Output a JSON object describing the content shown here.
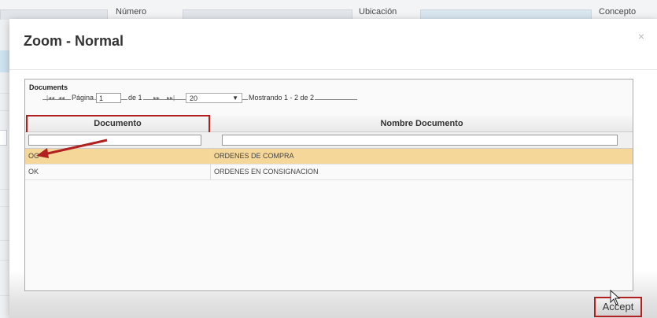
{
  "background": {
    "fields": [
      {
        "label": "Número"
      },
      {
        "label": "Ubicación"
      },
      {
        "label": "Concepto"
      }
    ]
  },
  "modal": {
    "title": "Zoom - Normal",
    "close_icon": "×"
  },
  "grid": {
    "caption": "Documents",
    "pager": {
      "first_icon": "|◂◂",
      "prev_icon": "◂◂",
      "page_label": "Página",
      "page_value": "1",
      "of_label": "de 1",
      "next_icon": "▸▸",
      "last_icon": "▸▸|",
      "page_size": "20",
      "dropdown_icon": "▼",
      "info": "Mostrando 1 - 2 de 2"
    },
    "columns": [
      "Documento",
      "Nombre Documento"
    ],
    "rows": [
      {
        "code": "OC",
        "name": "ORDENES DE COMPRA",
        "selected": true
      },
      {
        "code": "OK",
        "name": "ORDENES EN CONSIGNACION",
        "selected": false
      }
    ]
  },
  "footer": {
    "accept_label": "Accept"
  },
  "colors": {
    "highlight_red": "#b0211f",
    "selected_row": "#f6d79a"
  }
}
